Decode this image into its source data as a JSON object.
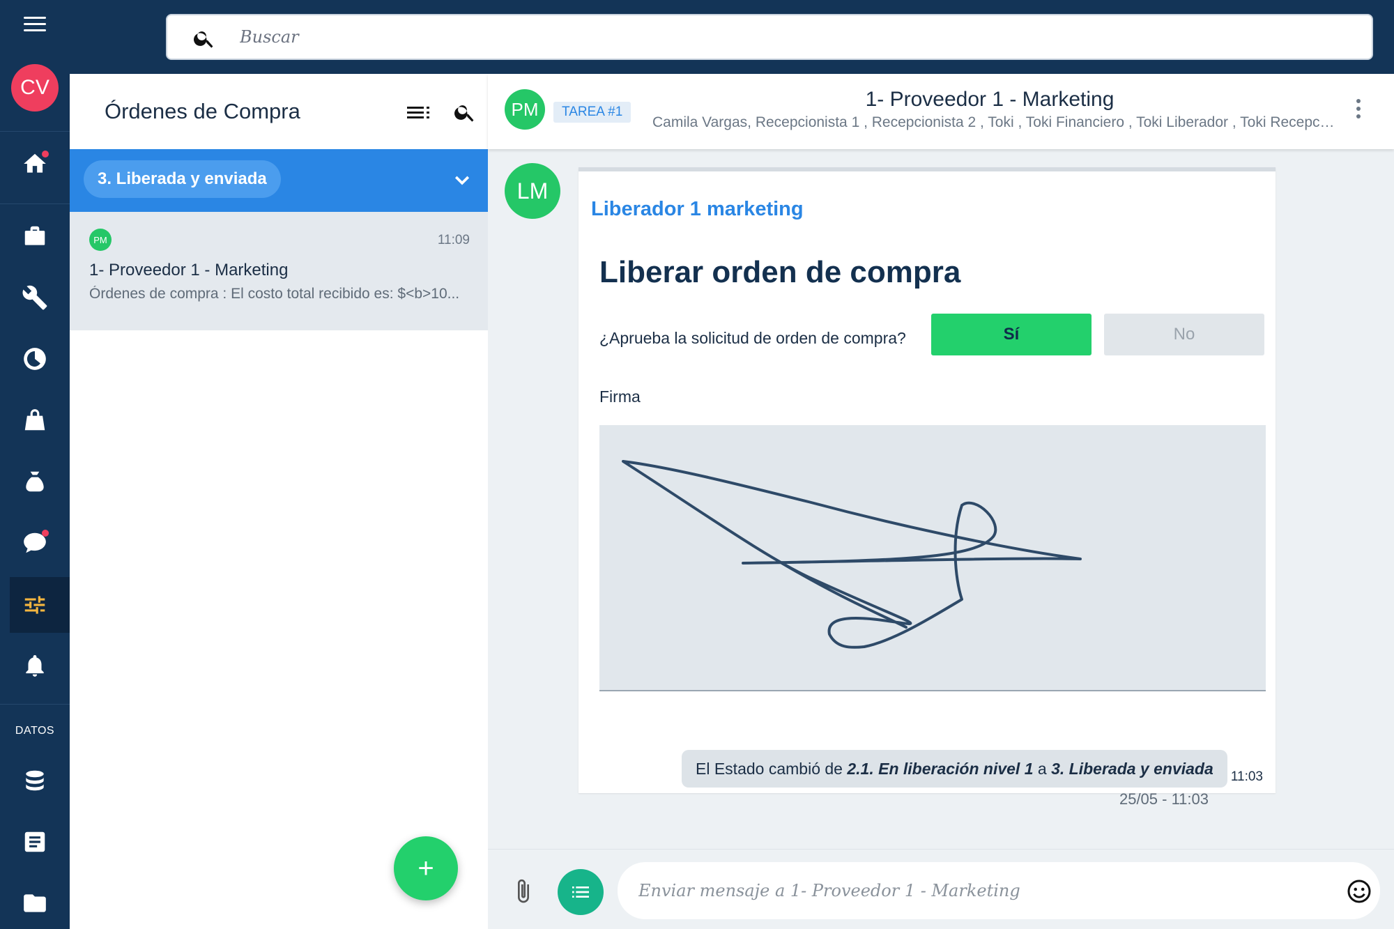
{
  "user": {
    "initials": "CV",
    "avatar_color": "#ef3e5e"
  },
  "search": {
    "placeholder": "Buscar"
  },
  "sidebar": {
    "section_label": "DATOS",
    "icons": [
      "home-icon",
      "briefcase-icon",
      "wrench-icon",
      "clock-icon",
      "bag-icon",
      "money-bag-icon",
      "chat-icon",
      "sliders-icon",
      "bell-icon",
      "database-icon",
      "document-icon",
      "folder-icon"
    ]
  },
  "list": {
    "title": "Órdenes de Compra",
    "status_filter": "3. Liberada y enviada",
    "items": [
      {
        "initials": "PM",
        "time": "11:09",
        "name": "1- Proveedor 1 - Marketing",
        "preview": "Órdenes de compra : El costo total recibido es: $<b>10..."
      }
    ]
  },
  "chat": {
    "avatar_initials": "PM",
    "task_badge": "TAREA #1",
    "title": "1- Proveedor 1 - Marketing",
    "members": "Camila Vargas, Recepcionista 1 , Recepcionista 2 , Toki , Toki Financiero , Toki Liberador , Toki Recepcionista"
  },
  "message": {
    "avatar_initials": "LM",
    "sender": "Liberador 1 marketing",
    "form_title": "Liberar orden de compra",
    "question": "¿Aprueba la solicitud de orden de compra?",
    "yes_label": "Sí",
    "no_label": "No",
    "signature_label": "Firma",
    "time": "11:03"
  },
  "system_message": {
    "prefix": "El Estado cambió de",
    "from_state": "2.1. En liberación nivel 1",
    "connector": "a",
    "to_state": "3. Liberada y enviada",
    "timestamp": "25/05 - 11:03"
  },
  "composer": {
    "placeholder": "Enviar mensaje a 1- Proveedor 1 - Marketing"
  },
  "colors": {
    "brand_dark": "#133457",
    "accent_blue": "#2a86e4",
    "accent_green": "#23d06c"
  }
}
